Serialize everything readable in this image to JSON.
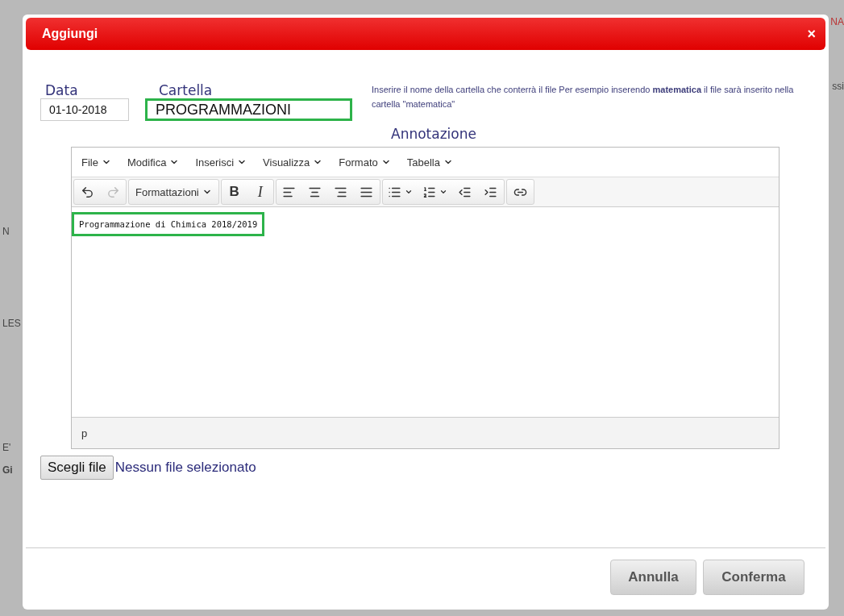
{
  "background": {
    "top_right": "NA",
    "right_fragment": "ssi",
    "left_fragments": [
      "N",
      "LES",
      "E'",
      "Gi"
    ]
  },
  "dialog": {
    "title": "Aggiungi",
    "close": "×",
    "date": {
      "label": "Data",
      "value": "01-10-2018"
    },
    "folder": {
      "label": "Cartella",
      "value": "PROGRAMMAZIONI",
      "highlighted": true
    },
    "help": "Inserire il nome della cartella che conterrà il file Per esempio inserendo **matematica** il file sarà inserito nella cartella \"matematica\"",
    "annotation_label": "Annotazione",
    "editor": {
      "menus": [
        "File",
        "Modifica",
        "Inserisci",
        "Visualizza",
        "Formato",
        "Tabella"
      ],
      "toolbar": {
        "undo_disabled": false,
        "redo_disabled": true,
        "format_label": "Formattazioni",
        "bold": "B",
        "italic": "I"
      },
      "content": "Programmazione di Chimica 2018/2019",
      "content_highlighted": true,
      "status_path": "p"
    },
    "file": {
      "button": "Scegli file",
      "status": "Nessun file selezionato"
    },
    "buttons": [
      "Annulla",
      "Conferma"
    ]
  }
}
